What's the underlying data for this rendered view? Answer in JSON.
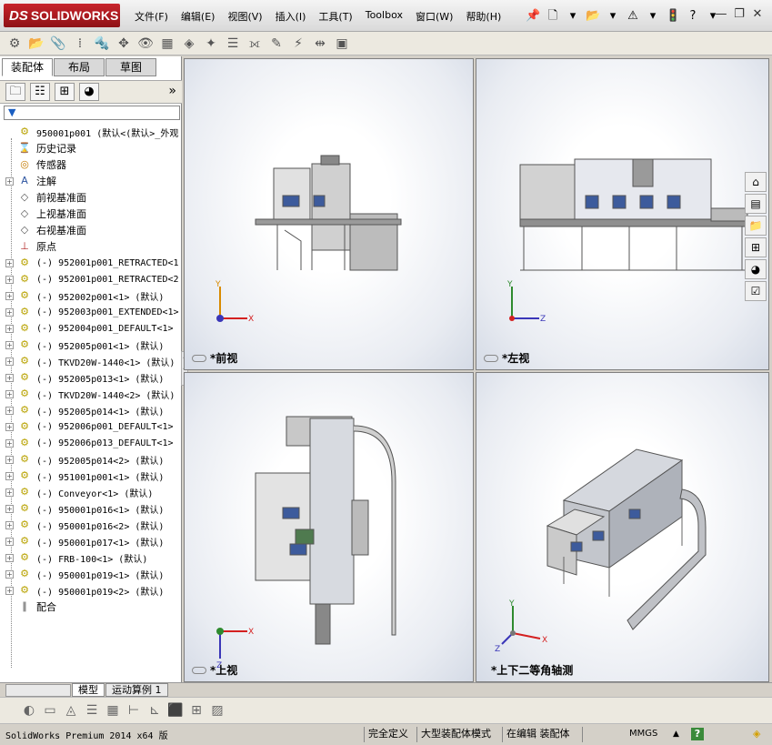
{
  "app": {
    "logo_ds": "DS",
    "logo_text": "SOLIDWORKS"
  },
  "menu": [
    "文件(F)",
    "编辑(E)",
    "视图(V)",
    "插入(I)",
    "工具(T)",
    "Toolbox",
    "窗口(W)",
    "帮助(H)"
  ],
  "panel": {
    "tabs": [
      "装配体",
      "布局",
      "草图"
    ],
    "more": "»",
    "filter": "▼",
    "tree": [
      {
        "label": "950001p001   (默认<(默认>_外观",
        "icon": "assembly-icon",
        "exp": false,
        "mono": true
      },
      {
        "label": "历史记录",
        "icon": "history-icon",
        "exp": false,
        "mono": false
      },
      {
        "label": "传感器",
        "icon": "sensor-icon",
        "exp": false,
        "mono": false
      },
      {
        "label": "注解",
        "icon": "annotation-icon",
        "exp": true,
        "mono": false
      },
      {
        "label": "前视基准面",
        "icon": "plane-icon",
        "exp": false,
        "mono": false
      },
      {
        "label": "上视基准面",
        "icon": "plane-icon",
        "exp": false,
        "mono": false
      },
      {
        "label": "右视基准面",
        "icon": "plane-icon",
        "exp": false,
        "mono": false
      },
      {
        "label": "原点",
        "icon": "origin-icon",
        "exp": false,
        "mono": false
      },
      {
        "label": "(-) 952001p001_RETRACTED<1",
        "icon": "subassembly-icon",
        "exp": true,
        "mono": true
      },
      {
        "label": "(-) 952001p001_RETRACTED<2",
        "icon": "subassembly-icon",
        "exp": true,
        "mono": true
      },
      {
        "label": "(-) 952002p001<1> (默认)",
        "icon": "subassembly-icon",
        "exp": true,
        "mono": true
      },
      {
        "label": "(-) 952003p001_EXTENDED<1>",
        "icon": "subassembly-icon",
        "exp": true,
        "mono": true
      },
      {
        "label": "(-) 952004p001_DEFAULT<1>",
        "icon": "subassembly-icon",
        "exp": true,
        "mono": true
      },
      {
        "label": "(-) 952005p001<1> (默认)",
        "icon": "subassembly-icon",
        "exp": true,
        "mono": true
      },
      {
        "label": "(-) TKVD20W-1440<1> (默认)",
        "icon": "subassembly-icon",
        "exp": true,
        "mono": true
      },
      {
        "label": "(-) 952005p013<1> (默认)",
        "icon": "subassembly-icon",
        "exp": true,
        "mono": true
      },
      {
        "label": "(-) TKVD20W-1440<2> (默认)",
        "icon": "subassembly-icon",
        "exp": true,
        "mono": true
      },
      {
        "label": "(-) 952005p014<1> (默认)",
        "icon": "subassembly-icon",
        "exp": true,
        "mono": true
      },
      {
        "label": "(-) 952006p001_DEFAULT<1>",
        "icon": "subassembly-icon",
        "exp": true,
        "mono": true
      },
      {
        "label": "(-) 952006p013_DEFAULT<1>",
        "icon": "subassembly-icon",
        "exp": true,
        "mono": true
      },
      {
        "label": "(-) 952005p014<2> (默认)",
        "icon": "subassembly-icon",
        "exp": true,
        "mono": true
      },
      {
        "label": "(-) 951001p001<1> (默认)",
        "icon": "subassembly-icon",
        "exp": true,
        "mono": true
      },
      {
        "label": "(-) Conveyor<1> (默认)",
        "icon": "subassembly-icon",
        "exp": true,
        "mono": true
      },
      {
        "label": "(-) 950001p016<1> (默认)",
        "icon": "subassembly-icon",
        "exp": true,
        "mono": true
      },
      {
        "label": "(-) 950001p016<2> (默认)",
        "icon": "subassembly-icon",
        "exp": true,
        "mono": true
      },
      {
        "label": "(-) 950001p017<1> (默认)",
        "icon": "subassembly-icon",
        "exp": true,
        "mono": true
      },
      {
        "label": "(-) FRB-100<1> (默认)",
        "icon": "subassembly-icon",
        "exp": true,
        "mono": true
      },
      {
        "label": "(-) 950001p019<1> (默认)",
        "icon": "subassembly-icon",
        "exp": true,
        "mono": true
      },
      {
        "label": "(-) 950001p019<2> (默认)",
        "icon": "subassembly-icon",
        "exp": true,
        "mono": true
      },
      {
        "label": "配合",
        "icon": "mates-icon",
        "exp": false,
        "mono": false
      }
    ]
  },
  "views": {
    "front": "*前视",
    "left": "*左视",
    "top": "*上视",
    "iso": "*上下二等角轴测"
  },
  "axes": {
    "x": "X",
    "y": "Y",
    "z": "Z"
  },
  "bottom_tabs": [
    "模型",
    "运动算例 1"
  ],
  "status": {
    "product": "SolidWorks Premium 2014 x64 版",
    "state": "完全定义",
    "mode": "大型装配体模式",
    "editing": "在编辑 装配体",
    "units": "MMGS",
    "help": "?"
  }
}
